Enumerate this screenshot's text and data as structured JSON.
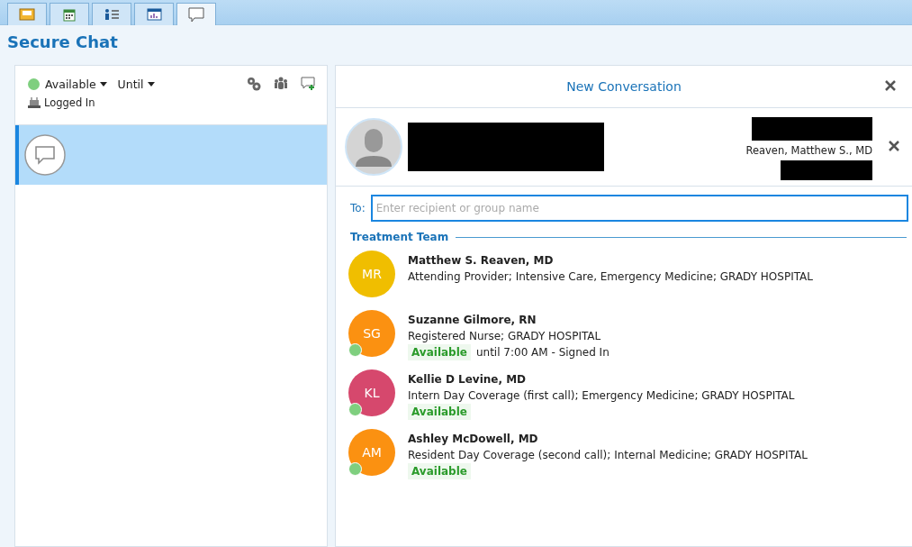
{
  "toolbar_tabs": [
    {
      "kind": "inbox",
      "selected": false
    },
    {
      "kind": "calendar",
      "selected": false
    },
    {
      "kind": "list",
      "selected": false
    },
    {
      "kind": "chart",
      "selected": false
    },
    {
      "kind": "chat",
      "selected": true
    }
  ],
  "title": "Secure Chat",
  "sidebar": {
    "presence": {
      "status": "Available",
      "color": "#7fcf7f",
      "until": "Until"
    },
    "login": "Logged In",
    "conversations": [
      {
        "selected": true
      }
    ]
  },
  "conversation": {
    "title": "New Conversation",
    "sender": {
      "name": "Reaven, Matthew S., MD"
    },
    "to_label": "To:",
    "recipient_field": {
      "placeholder": "Enter recipient or group name"
    },
    "section": "Treatment Team",
    "members": [
      {
        "initials": "MR",
        "color": "#f0be00",
        "name": "Matthew S. Reaven, MD",
        "detail": "Attending Provider; Intensive Care, Emergency Medicine; GRADY HOSPITAL",
        "online": false
      },
      {
        "initials": "SG",
        "color": "#fb9111",
        "name": "Suzanne Gilmore, RN",
        "detail": "Registered Nurse; GRADY HOSPITAL",
        "online": true,
        "status": "Available",
        "status_note": "until 7:00 AM - Signed In"
      },
      {
        "initials": "KL",
        "color": "#d6486d",
        "name": "Kellie D Levine, MD",
        "detail": "Intern Day Coverage (first call); Emergency Medicine; GRADY HOSPITAL",
        "online": true,
        "status": "Available"
      },
      {
        "initials": "AM",
        "color": "#fb9111",
        "name": "Ashley McDowell, MD",
        "detail": "Resident Day Coverage (second call); Internal Medicine; GRADY HOSPITAL",
        "online": true,
        "status": "Available"
      }
    ]
  }
}
